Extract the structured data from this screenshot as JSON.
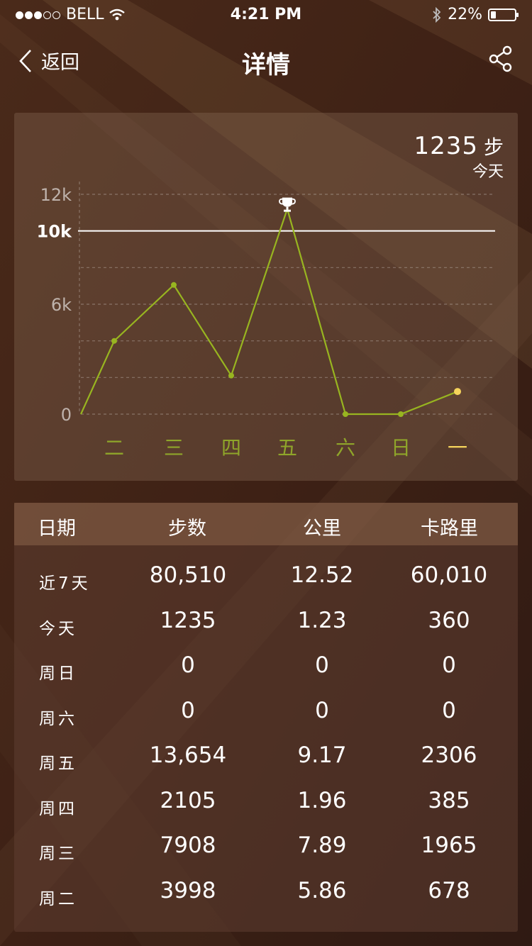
{
  "status_bar": {
    "carrier": "BELL",
    "time": "4:21 PM",
    "battery_text": "22%",
    "battery_level": 0.22
  },
  "nav": {
    "back_label": "返回",
    "title": "详情"
  },
  "today": {
    "steps": "1235",
    "unit": "步",
    "label": "今天"
  },
  "chart_data": {
    "type": "line",
    "categories": [
      "",
      "二",
      "三",
      "四",
      "五",
      "六",
      "日",
      "一"
    ],
    "values": [
      0,
      3998,
      7053,
      2105,
      11200,
      0,
      0,
      1235
    ],
    "ylim": [
      0,
      12000
    ],
    "yticks": [
      "12k",
      "10k",
      "6k",
      "0"
    ],
    "goal_value": 10000,
    "highlight_today": "一",
    "line_color": "#98b520",
    "today_color": "#f6d45c"
  },
  "table": {
    "headers": [
      "日期",
      "步数",
      "公里",
      "卡路里"
    ],
    "rows": [
      {
        "label": "近7天",
        "steps": "80,510",
        "km": "12.52",
        "cal": "60,010"
      },
      {
        "label": "今天",
        "steps": "1235",
        "km": "1.23",
        "cal": "360"
      },
      {
        "label": "周日",
        "steps": "0",
        "km": "0",
        "cal": "0"
      },
      {
        "label": "周六",
        "steps": "0",
        "km": "0",
        "cal": "0"
      },
      {
        "label": "周五",
        "steps": "13,654",
        "km": "9.17",
        "cal": "2306"
      },
      {
        "label": "周四",
        "steps": "2105",
        "km": "1.96",
        "cal": "385"
      },
      {
        "label": "周三",
        "steps": "7908",
        "km": "7.89",
        "cal": "1965"
      },
      {
        "label": "周二",
        "steps": "3998",
        "km": "5.86",
        "cal": "678"
      }
    ]
  }
}
